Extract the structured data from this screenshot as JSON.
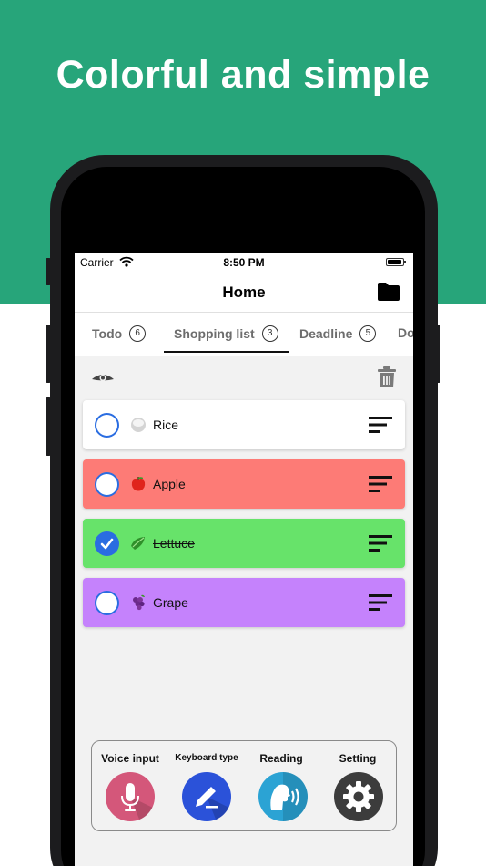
{
  "promo": {
    "headline": "Colorful and simple"
  },
  "status_bar": {
    "carrier": "Carrier",
    "time": "8:50 PM"
  },
  "nav": {
    "title": "Home",
    "folder_icon": "folder-icon"
  },
  "tabs": [
    {
      "label": "Todo",
      "count": "6"
    },
    {
      "label": "Shopping list",
      "count": "3",
      "active": true
    },
    {
      "label": "Deadline",
      "count": "5"
    },
    {
      "label": "Do"
    }
  ],
  "toolbar": {
    "visibility_icon": "eye-icon",
    "delete_icon": "trash-icon"
  },
  "items": [
    {
      "label": "Rice",
      "emoji": "rice-icon",
      "checked": false,
      "color": "#ffffff"
    },
    {
      "label": "Apple",
      "emoji": "apple-icon",
      "checked": false,
      "color": "#fd7b76"
    },
    {
      "label": "Lettuce",
      "emoji": "lettuce-icon",
      "checked": true,
      "color": "#67e36a"
    },
    {
      "label": "Grape",
      "emoji": "grape-icon",
      "checked": false,
      "color": "#c582fc"
    }
  ],
  "input_panel": {
    "voice_input": "Voice input",
    "keyboard_type": "Keyboard type",
    "reading": "Reading",
    "setting": "Setting"
  },
  "colors": {
    "promo_background": "#27a57a",
    "accent_blue": "#2a6de1",
    "voice_button": "#d4577a",
    "keyboard_button": "#2b52d9",
    "reading_button": "#2ba3d4",
    "setting_button": "#3c3c3c"
  }
}
